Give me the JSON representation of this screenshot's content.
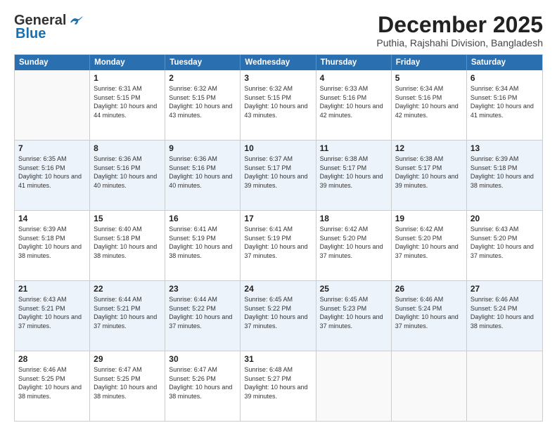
{
  "logo": {
    "general": "General",
    "blue": "Blue"
  },
  "title": "December 2025",
  "subtitle": "Puthia, Rajshahi Division, Bangladesh",
  "days_of_week": [
    "Sunday",
    "Monday",
    "Tuesday",
    "Wednesday",
    "Thursday",
    "Friday",
    "Saturday"
  ],
  "weeks": [
    {
      "bg": "odd",
      "cells": [
        {
          "day": "",
          "sunrise": "",
          "sunset": "",
          "daylight": "",
          "empty": true
        },
        {
          "day": "1",
          "sunrise": "Sunrise: 6:31 AM",
          "sunset": "Sunset: 5:15 PM",
          "daylight": "Daylight: 10 hours and 44 minutes.",
          "empty": false
        },
        {
          "day": "2",
          "sunrise": "Sunrise: 6:32 AM",
          "sunset": "Sunset: 5:15 PM",
          "daylight": "Daylight: 10 hours and 43 minutes.",
          "empty": false
        },
        {
          "day": "3",
          "sunrise": "Sunrise: 6:32 AM",
          "sunset": "Sunset: 5:15 PM",
          "daylight": "Daylight: 10 hours and 43 minutes.",
          "empty": false
        },
        {
          "day": "4",
          "sunrise": "Sunrise: 6:33 AM",
          "sunset": "Sunset: 5:16 PM",
          "daylight": "Daylight: 10 hours and 42 minutes.",
          "empty": false
        },
        {
          "day": "5",
          "sunrise": "Sunrise: 6:34 AM",
          "sunset": "Sunset: 5:16 PM",
          "daylight": "Daylight: 10 hours and 42 minutes.",
          "empty": false
        },
        {
          "day": "6",
          "sunrise": "Sunrise: 6:34 AM",
          "sunset": "Sunset: 5:16 PM",
          "daylight": "Daylight: 10 hours and 41 minutes.",
          "empty": false
        }
      ]
    },
    {
      "bg": "even",
      "cells": [
        {
          "day": "7",
          "sunrise": "Sunrise: 6:35 AM",
          "sunset": "Sunset: 5:16 PM",
          "daylight": "Daylight: 10 hours and 41 minutes.",
          "empty": false
        },
        {
          "day": "8",
          "sunrise": "Sunrise: 6:36 AM",
          "sunset": "Sunset: 5:16 PM",
          "daylight": "Daylight: 10 hours and 40 minutes.",
          "empty": false
        },
        {
          "day": "9",
          "sunrise": "Sunrise: 6:36 AM",
          "sunset": "Sunset: 5:16 PM",
          "daylight": "Daylight: 10 hours and 40 minutes.",
          "empty": false
        },
        {
          "day": "10",
          "sunrise": "Sunrise: 6:37 AM",
          "sunset": "Sunset: 5:17 PM",
          "daylight": "Daylight: 10 hours and 39 minutes.",
          "empty": false
        },
        {
          "day": "11",
          "sunrise": "Sunrise: 6:38 AM",
          "sunset": "Sunset: 5:17 PM",
          "daylight": "Daylight: 10 hours and 39 minutes.",
          "empty": false
        },
        {
          "day": "12",
          "sunrise": "Sunrise: 6:38 AM",
          "sunset": "Sunset: 5:17 PM",
          "daylight": "Daylight: 10 hours and 39 minutes.",
          "empty": false
        },
        {
          "day": "13",
          "sunrise": "Sunrise: 6:39 AM",
          "sunset": "Sunset: 5:18 PM",
          "daylight": "Daylight: 10 hours and 38 minutes.",
          "empty": false
        }
      ]
    },
    {
      "bg": "odd",
      "cells": [
        {
          "day": "14",
          "sunrise": "Sunrise: 6:39 AM",
          "sunset": "Sunset: 5:18 PM",
          "daylight": "Daylight: 10 hours and 38 minutes.",
          "empty": false
        },
        {
          "day": "15",
          "sunrise": "Sunrise: 6:40 AM",
          "sunset": "Sunset: 5:18 PM",
          "daylight": "Daylight: 10 hours and 38 minutes.",
          "empty": false
        },
        {
          "day": "16",
          "sunrise": "Sunrise: 6:41 AM",
          "sunset": "Sunset: 5:19 PM",
          "daylight": "Daylight: 10 hours and 38 minutes.",
          "empty": false
        },
        {
          "day": "17",
          "sunrise": "Sunrise: 6:41 AM",
          "sunset": "Sunset: 5:19 PM",
          "daylight": "Daylight: 10 hours and 37 minutes.",
          "empty": false
        },
        {
          "day": "18",
          "sunrise": "Sunrise: 6:42 AM",
          "sunset": "Sunset: 5:20 PM",
          "daylight": "Daylight: 10 hours and 37 minutes.",
          "empty": false
        },
        {
          "day": "19",
          "sunrise": "Sunrise: 6:42 AM",
          "sunset": "Sunset: 5:20 PM",
          "daylight": "Daylight: 10 hours and 37 minutes.",
          "empty": false
        },
        {
          "day": "20",
          "sunrise": "Sunrise: 6:43 AM",
          "sunset": "Sunset: 5:20 PM",
          "daylight": "Daylight: 10 hours and 37 minutes.",
          "empty": false
        }
      ]
    },
    {
      "bg": "even",
      "cells": [
        {
          "day": "21",
          "sunrise": "Sunrise: 6:43 AM",
          "sunset": "Sunset: 5:21 PM",
          "daylight": "Daylight: 10 hours and 37 minutes.",
          "empty": false
        },
        {
          "day": "22",
          "sunrise": "Sunrise: 6:44 AM",
          "sunset": "Sunset: 5:21 PM",
          "daylight": "Daylight: 10 hours and 37 minutes.",
          "empty": false
        },
        {
          "day": "23",
          "sunrise": "Sunrise: 6:44 AM",
          "sunset": "Sunset: 5:22 PM",
          "daylight": "Daylight: 10 hours and 37 minutes.",
          "empty": false
        },
        {
          "day": "24",
          "sunrise": "Sunrise: 6:45 AM",
          "sunset": "Sunset: 5:22 PM",
          "daylight": "Daylight: 10 hours and 37 minutes.",
          "empty": false
        },
        {
          "day": "25",
          "sunrise": "Sunrise: 6:45 AM",
          "sunset": "Sunset: 5:23 PM",
          "daylight": "Daylight: 10 hours and 37 minutes.",
          "empty": false
        },
        {
          "day": "26",
          "sunrise": "Sunrise: 6:46 AM",
          "sunset": "Sunset: 5:24 PM",
          "daylight": "Daylight: 10 hours and 37 minutes.",
          "empty": false
        },
        {
          "day": "27",
          "sunrise": "Sunrise: 6:46 AM",
          "sunset": "Sunset: 5:24 PM",
          "daylight": "Daylight: 10 hours and 38 minutes.",
          "empty": false
        }
      ]
    },
    {
      "bg": "odd",
      "cells": [
        {
          "day": "28",
          "sunrise": "Sunrise: 6:46 AM",
          "sunset": "Sunset: 5:25 PM",
          "daylight": "Daylight: 10 hours and 38 minutes.",
          "empty": false
        },
        {
          "day": "29",
          "sunrise": "Sunrise: 6:47 AM",
          "sunset": "Sunset: 5:25 PM",
          "daylight": "Daylight: 10 hours and 38 minutes.",
          "empty": false
        },
        {
          "day": "30",
          "sunrise": "Sunrise: 6:47 AM",
          "sunset": "Sunset: 5:26 PM",
          "daylight": "Daylight: 10 hours and 38 minutes.",
          "empty": false
        },
        {
          "day": "31",
          "sunrise": "Sunrise: 6:48 AM",
          "sunset": "Sunset: 5:27 PM",
          "daylight": "Daylight: 10 hours and 39 minutes.",
          "empty": false
        },
        {
          "day": "",
          "sunrise": "",
          "sunset": "",
          "daylight": "",
          "empty": true
        },
        {
          "day": "",
          "sunrise": "",
          "sunset": "",
          "daylight": "",
          "empty": true
        },
        {
          "day": "",
          "sunrise": "",
          "sunset": "",
          "daylight": "",
          "empty": true
        }
      ]
    }
  ]
}
